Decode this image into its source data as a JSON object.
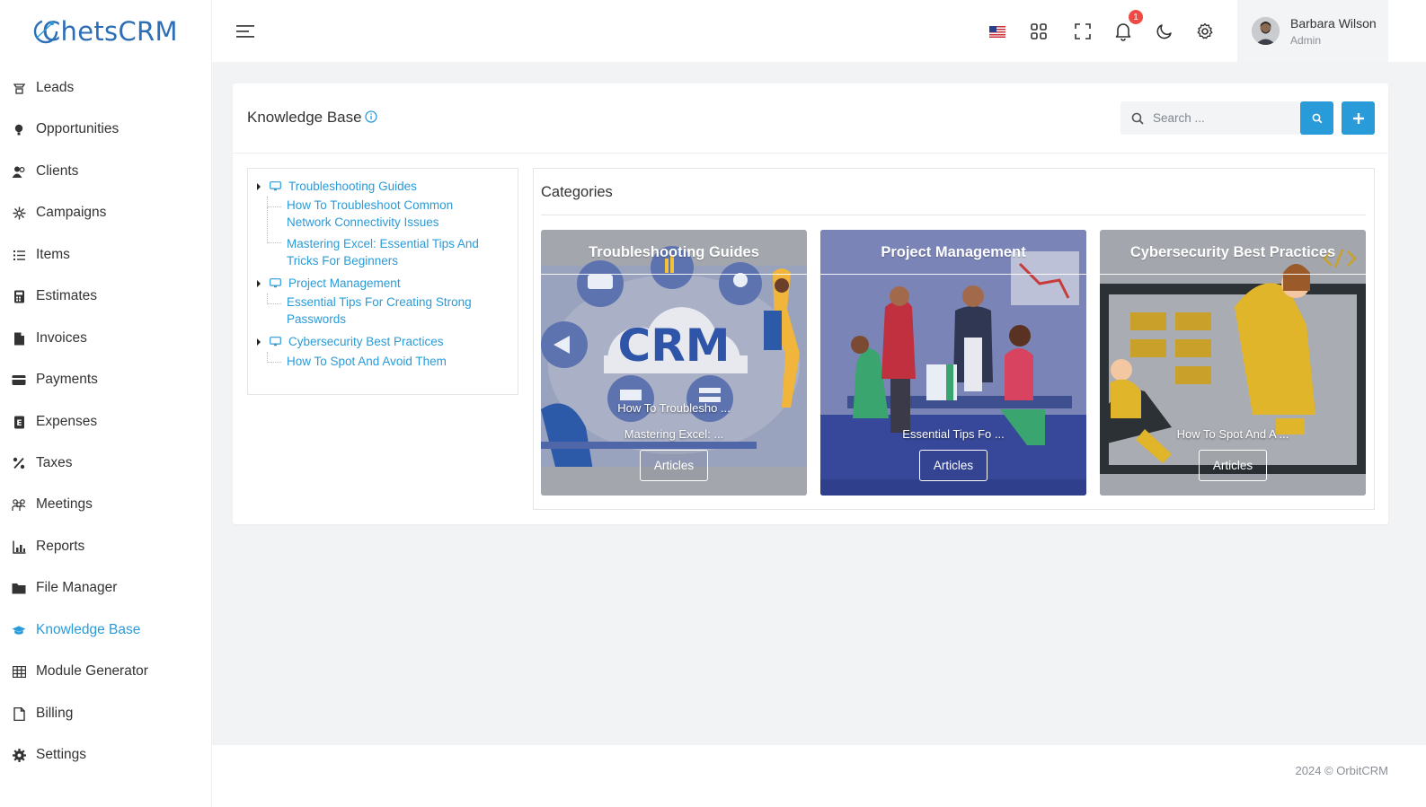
{
  "app": {
    "logo_text": "ChetsCRM",
    "footer": "2024 © OrbitCRM"
  },
  "sidebar": {
    "items": [
      {
        "label": "Leads",
        "icon": "leads-icon"
      },
      {
        "label": "Opportunities",
        "icon": "lightbulb-icon"
      },
      {
        "label": "Clients",
        "icon": "clients-icon"
      },
      {
        "label": "Campaigns",
        "icon": "campaigns-icon"
      },
      {
        "label": "Items",
        "icon": "list-icon"
      },
      {
        "label": "Estimates",
        "icon": "calculator-icon"
      },
      {
        "label": "Invoices",
        "icon": "invoice-icon"
      },
      {
        "label": "Payments",
        "icon": "credit-card-icon"
      },
      {
        "label": "Expenses",
        "icon": "expense-icon"
      },
      {
        "label": "Taxes",
        "icon": "percent-icon"
      },
      {
        "label": "Meetings",
        "icon": "meetings-icon"
      },
      {
        "label": "Reports",
        "icon": "chart-icon"
      },
      {
        "label": "File Manager",
        "icon": "folder-icon"
      },
      {
        "label": "Knowledge Base",
        "icon": "graduation-cap-icon",
        "active": true
      },
      {
        "label": "Module Generator",
        "icon": "grid-icon"
      },
      {
        "label": "Billing",
        "icon": "document-icon"
      },
      {
        "label": "Settings",
        "icon": "gear-icon"
      }
    ]
  },
  "header": {
    "notification_count": "1",
    "user": {
      "name": "Barbara Wilson",
      "role": "Admin"
    }
  },
  "page": {
    "title": "Knowledge Base",
    "search_placeholder": "Search ..."
  },
  "tree": {
    "categories": [
      {
        "label": "Troubleshooting Guides",
        "articles": [
          "How To Troubleshoot Common Network Connectivity Issues",
          "Mastering Excel: Essential Tips And Tricks For Beginners"
        ]
      },
      {
        "label": "Project Management",
        "articles": [
          "Essential Tips For Creating Strong Passwords"
        ]
      },
      {
        "label": "Cybersecurity Best Practices",
        "articles": [
          "How To Spot And Avoid Them"
        ]
      }
    ]
  },
  "categories": {
    "title": "Categories",
    "cards": [
      {
        "name": "Troubleshooting Guides",
        "articles": [
          "How To Troublesho ...",
          "Mastering Excel: ..."
        ],
        "button": "Articles"
      },
      {
        "name": "Project Management",
        "articles": [
          "Essential Tips Fo ..."
        ],
        "button": "Articles"
      },
      {
        "name": "Cybersecurity Best Practices",
        "articles": [
          "How To Spot And A ..."
        ],
        "button": "Articles"
      }
    ],
    "crm_art_text": "CRM"
  }
}
